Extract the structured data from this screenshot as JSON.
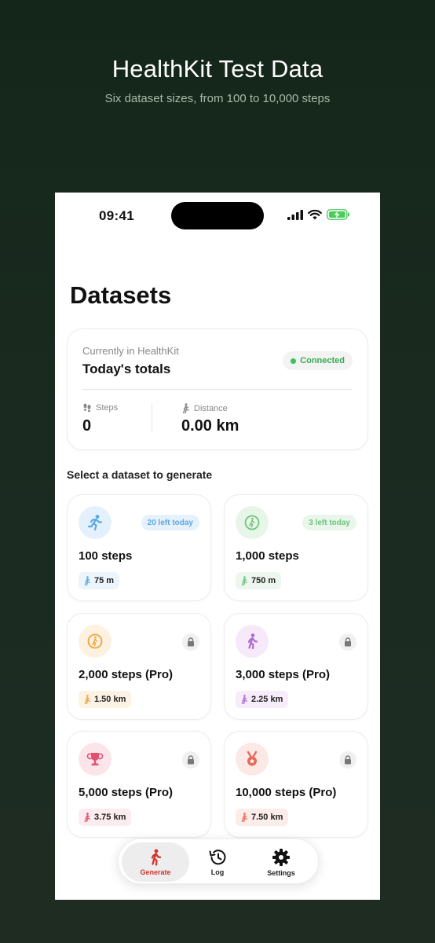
{
  "promo": {
    "title": "HealthKit Test Data",
    "subtitle": "Six dataset sizes, from 100 to 10,000 steps"
  },
  "status_bar": {
    "time": "09:41"
  },
  "page": {
    "title": "Datasets"
  },
  "totals": {
    "caption": "Currently in HealthKit",
    "heading": "Today's totals",
    "connection_status": "Connected",
    "steps_label": "Steps",
    "steps_value": "0",
    "distance_label": "Distance",
    "distance_value": "0.00 km"
  },
  "section_label": "Select a dataset to generate",
  "datasets": [
    {
      "title": "100 steps",
      "distance": "75 m",
      "badge": "20 left today",
      "locked": false,
      "icon": "running-icon",
      "accent": "#5aa9e6"
    },
    {
      "title": "1,000 steps",
      "distance": "750 m",
      "badge": "3 left today",
      "locked": false,
      "icon": "walking-circle-icon",
      "accent": "#6cc47a"
    },
    {
      "title": "2,000 steps (Pro)",
      "distance": "1.50 km",
      "badge": "",
      "locked": true,
      "icon": "walking-circle-icon",
      "accent": "#f2a33a"
    },
    {
      "title": "3,000 steps (Pro)",
      "distance": "2.25 km",
      "badge": "",
      "locked": true,
      "icon": "walking-icon",
      "accent": "#b06ad0"
    },
    {
      "title": "5,000 steps (Pro)",
      "distance": "3.75 km",
      "badge": "",
      "locked": true,
      "icon": "trophy-icon",
      "accent": "#e4506f"
    },
    {
      "title": "10,000 steps (Pro)",
      "distance": "7.50 km",
      "badge": "",
      "locked": true,
      "icon": "medal-icon",
      "accent": "#e8695b"
    }
  ],
  "tabbar": {
    "generate": "Generate",
    "log": "Log",
    "settings": "Settings"
  },
  "colors": {
    "background": "#1c2b21",
    "connected": "#3aaa55",
    "active_tab": "#d0342c"
  }
}
